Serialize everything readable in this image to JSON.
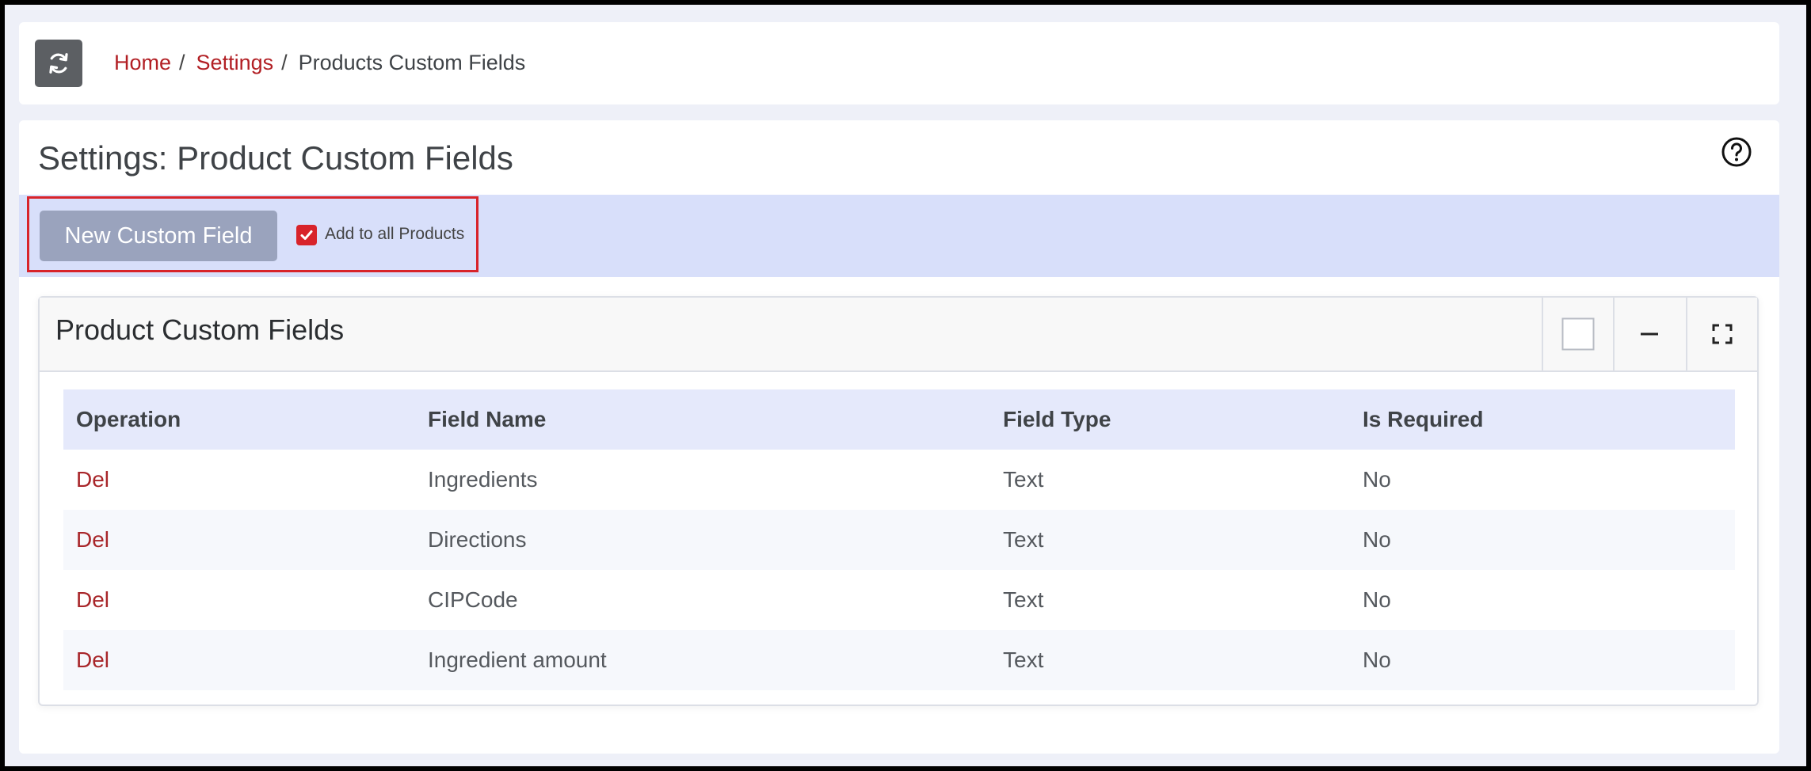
{
  "breadcrumb": {
    "home": "Home",
    "settings": "Settings",
    "separator": "/",
    "current": "Products Custom Fields"
  },
  "page": {
    "title": "Settings: Product Custom Fields"
  },
  "toolbar": {
    "new_button_label": "New Custom Field",
    "checkbox_label": "Add to all Products",
    "checkbox_checked": true
  },
  "card": {
    "title": "Product Custom Fields"
  },
  "table": {
    "headers": [
      "Operation",
      "Field Name",
      "Field Type",
      "Is Required"
    ],
    "rows": [
      {
        "operation": "Del",
        "field_name": "Ingredients",
        "field_type": "Text",
        "is_required": "No"
      },
      {
        "operation": "Del",
        "field_name": "Directions",
        "field_type": "Text",
        "is_required": "No"
      },
      {
        "operation": "Del",
        "field_name": "CIPCode",
        "field_type": "Text",
        "is_required": "No"
      },
      {
        "operation": "Del",
        "field_name": "Ingredient amount",
        "field_type": "Text",
        "is_required": "No"
      }
    ]
  },
  "icons": {
    "refresh": "refresh-icon",
    "help": "help-icon",
    "checkbox_square": "square-icon",
    "collapse": "minus-icon",
    "fullscreen": "expand-icon"
  },
  "colors": {
    "link": "#b21f24",
    "toolbar_bg": "#d8dffa",
    "highlight_border": "#d8232a",
    "button_bg": "#9aa3bd"
  }
}
